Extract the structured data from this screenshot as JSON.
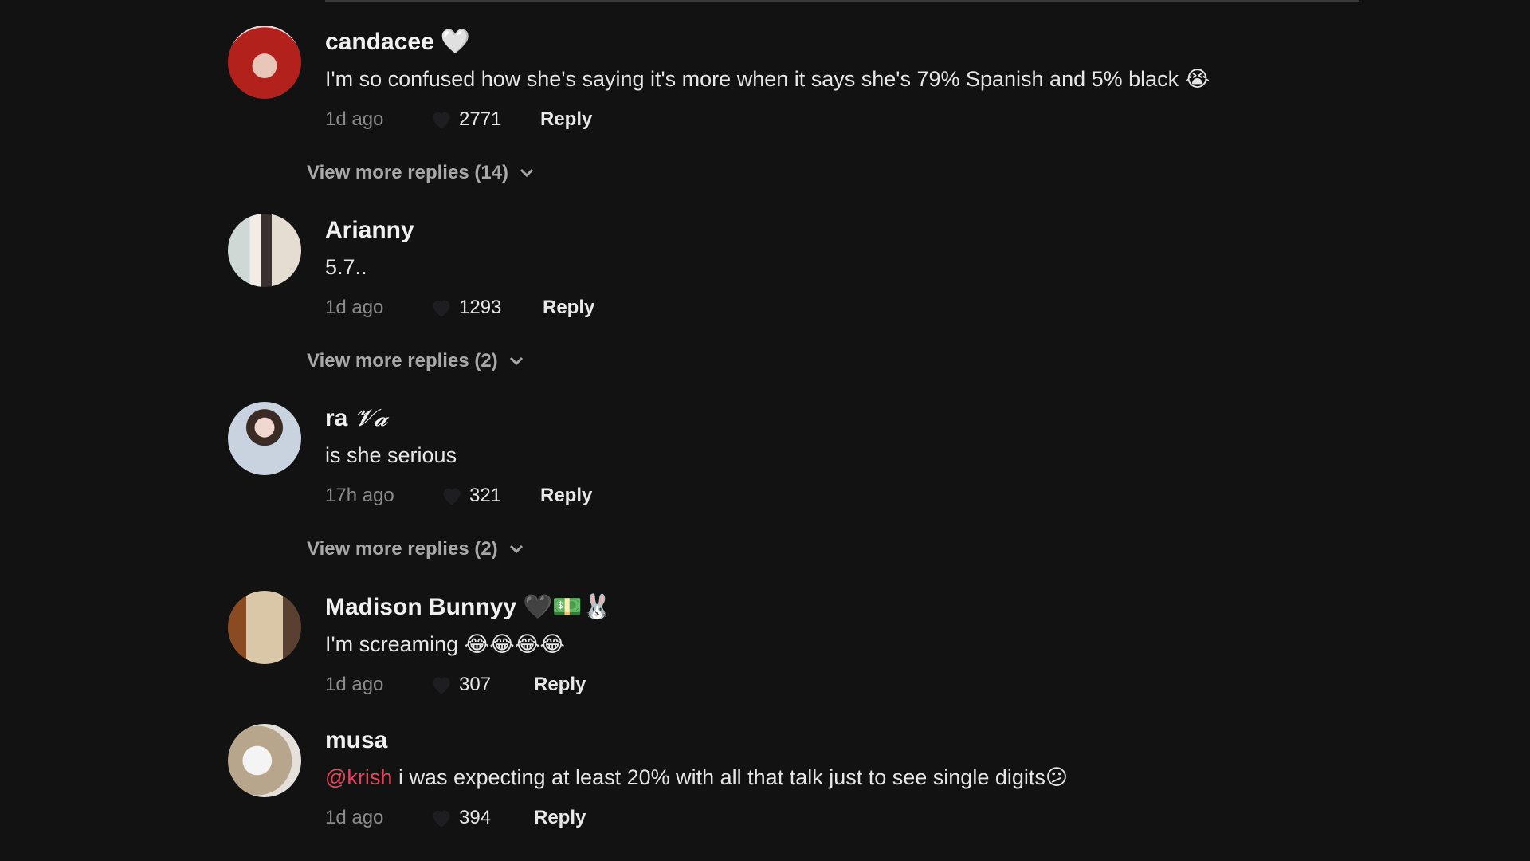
{
  "comments": [
    {
      "username": "candacee",
      "name_suffix": "🤍",
      "text": "I'm so confused how she's saying it's more when it says she's 79% Spanish and 5% black",
      "text_emoji": "😭",
      "mention": "",
      "time": "1d ago",
      "likes": "2771",
      "reply_label": "Reply",
      "avatar_colors": [
        "#b3211c",
        "#e9d6d8"
      ],
      "view_more": "View more replies (14)"
    },
    {
      "username": "Arianny",
      "name_suffix": "",
      "text": "5.7..",
      "text_emoji": "",
      "mention": "",
      "time": "1d ago",
      "likes": "1293",
      "reply_label": "Reply",
      "avatar_colors": [
        "#d8d2c8",
        "#6f8f8a"
      ],
      "view_more": "View more replies (2)"
    },
    {
      "username": "ra",
      "name_suffix": "𝓥𝓪",
      "text": "is she serious",
      "text_emoji": "",
      "mention": "",
      "time": "17h ago",
      "likes": "321",
      "reply_label": "Reply",
      "avatar_colors": [
        "#c9d3df",
        "#8aa9d6"
      ],
      "view_more": "View more replies (2)"
    },
    {
      "username": "Madison Bunnyy",
      "name_suffix": "🖤💵🐰",
      "text": "I'm screaming",
      "text_emoji": "😂😂😂😂",
      "mention": "",
      "time": "1d ago",
      "likes": "307",
      "reply_label": "Reply",
      "avatar_colors": [
        "#8a4a22",
        "#d9c7a8"
      ],
      "view_more": ""
    },
    {
      "username": "musa",
      "name_suffix": "",
      "text": "i was expecting at least 20% with all that talk just to see single digits",
      "text_emoji": "😕",
      "mention": "@krish",
      "time": "1d ago",
      "likes": "394",
      "reply_label": "Reply",
      "avatar_colors": [
        "#b7a58c",
        "#eeeeee"
      ],
      "view_more": ""
    }
  ],
  "colors": {
    "background": "#121212",
    "mention": "#e8415c",
    "muted": "#8a8a8a"
  }
}
